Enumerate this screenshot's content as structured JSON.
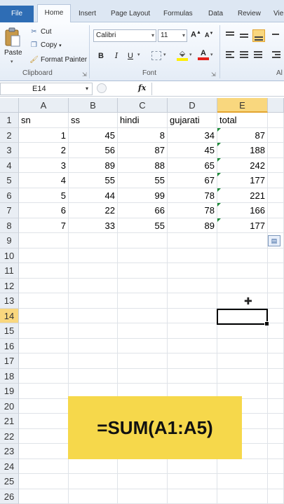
{
  "ribbon_tabs": [
    "File",
    "Home",
    "Insert",
    "Page Layout",
    "Formulas",
    "Data",
    "Review",
    "Vie"
  ],
  "clipboard": {
    "paste": "Paste",
    "cut": "Cut",
    "copy": "Copy",
    "format_painter": "Format Painter",
    "group_label": "Clipboard"
  },
  "font": {
    "name": "Calibri",
    "size": "11",
    "bold": "B",
    "italic": "I",
    "underline": "U",
    "grow": "A",
    "shrink": "A",
    "font_color": "A",
    "group_label": "Font"
  },
  "alignment": {
    "group_label": "Al"
  },
  "formula_bar": {
    "name_box": "E14",
    "fx": "fx",
    "formula": ""
  },
  "columns": [
    "A",
    "B",
    "C",
    "D",
    "E"
  ],
  "selected_column": "E",
  "selected_row": "14",
  "rows": [
    "1",
    "2",
    "3",
    "4",
    "5",
    "6",
    "7",
    "8",
    "9",
    "10",
    "11",
    "12",
    "13",
    "14",
    "15",
    "16",
    "17",
    "18",
    "19",
    "20",
    "21",
    "22",
    "23",
    "24",
    "25",
    "26"
  ],
  "headers": [
    "sn",
    "ss",
    "hindi",
    "gujarati",
    "total"
  ],
  "data_rows": [
    [
      "1",
      "45",
      "8",
      "34",
      "87"
    ],
    [
      "2",
      "56",
      "87",
      "45",
      "188"
    ],
    [
      "3",
      "89",
      "88",
      "65",
      "242"
    ],
    [
      "4",
      "55",
      "55",
      "67",
      "177"
    ],
    [
      "5",
      "44",
      "99",
      "78",
      "221"
    ],
    [
      "6",
      "22",
      "66",
      "78",
      "166"
    ],
    [
      "7",
      "33",
      "55",
      "89",
      "177"
    ]
  ],
  "overlay_text": "=SUM(A1:A5)",
  "colors": {
    "accent": "#2e6db5",
    "callout": "#f6d84b",
    "selected_header": "#f9d77e",
    "error_triangle": "#1e8c3a"
  }
}
